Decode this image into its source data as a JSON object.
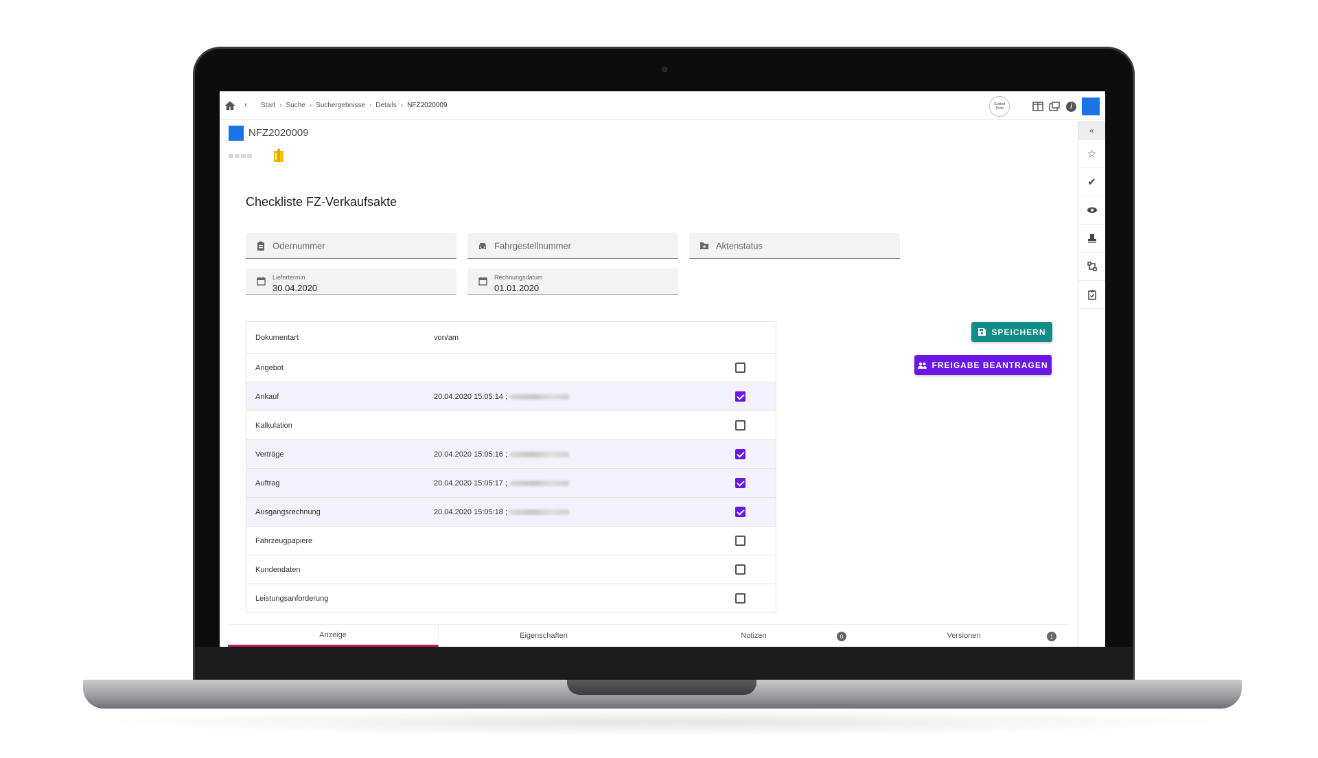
{
  "topbar": {
    "breadcrumbs": [
      "Start",
      "Suche",
      "Suchergebnisse",
      "Details",
      "NFZ2020009"
    ],
    "guided_tour_label": "Guided Tours"
  },
  "document": {
    "title": "NFZ2020009",
    "section_title": "Checkliste FZ-Verkaufsakte"
  },
  "fields": {
    "order_number_placeholder": "Odernummer",
    "vin_placeholder": "Fahrgestellnummer",
    "file_status_placeholder": "Aktenstatus",
    "delivery_label": "Liefertermin",
    "delivery_value": "30.04.2020",
    "invoice_label": "Rechnungsdatum",
    "invoice_value": "01.01.2020"
  },
  "buttons": {
    "save": "SPEICHERN",
    "release": "FREIGABE BEANTRAGEN"
  },
  "table": {
    "headers": [
      "Dokumentart",
      "von/am"
    ],
    "rows": [
      {
        "type": "Angebot",
        "date": "",
        "checked": false
      },
      {
        "type": "Ankauf",
        "date": "20.04.2020 15:05:14 ;",
        "checked": true
      },
      {
        "type": "Kalkulation",
        "date": "",
        "checked": false
      },
      {
        "type": "Verträge",
        "date": "20.04.2020 15:05:16 ;",
        "checked": true
      },
      {
        "type": "Auftrag",
        "date": "20.04.2020 15:05:17 ;",
        "checked": true
      },
      {
        "type": "Ausgangsrechnung",
        "date": "20.04.2020 15:05:18 ;",
        "checked": true
      },
      {
        "type": "Fahrzeugpapiere",
        "date": "",
        "checked": false
      },
      {
        "type": "Kundendaten",
        "date": "",
        "checked": false
      },
      {
        "type": "Leistungsanforderung",
        "date": "",
        "checked": false
      }
    ]
  },
  "tabs": [
    {
      "label": "Anzeige",
      "badge": ""
    },
    {
      "label": "Eigenschaften",
      "badge": ""
    },
    {
      "label": "Notizen",
      "badge": "0"
    },
    {
      "label": "Versionen",
      "badge": "1"
    }
  ],
  "colors": {
    "accent_purple": "#6a16e6",
    "save_teal": "#138b87",
    "active_tab": "#c2185b",
    "brand_blue": "#1a73e8"
  }
}
